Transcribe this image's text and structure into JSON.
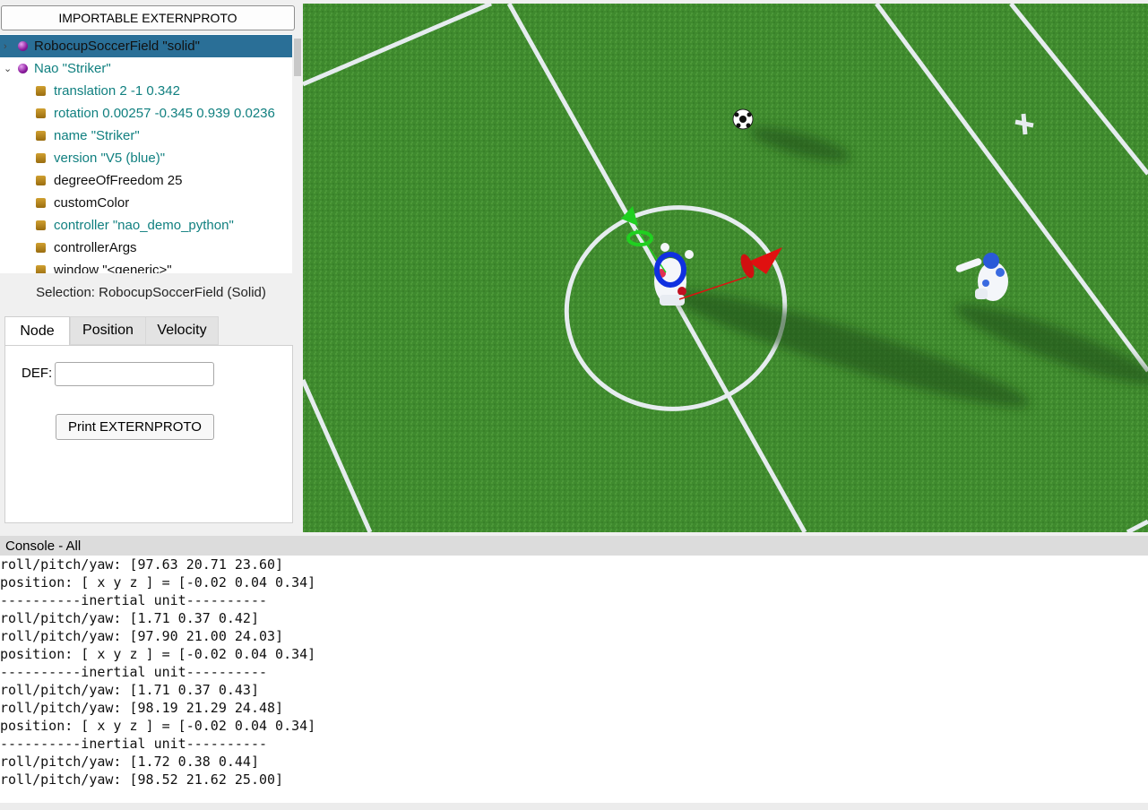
{
  "left_panel": {
    "import_button": "IMPORTABLE EXTERNPROTO",
    "tree": [
      {
        "label": "RobocupSoccerField \"solid\"",
        "kind": "node",
        "expander": "›",
        "selected": true,
        "color": "black"
      },
      {
        "label": "Nao \"Striker\"",
        "kind": "node",
        "expander": "⌄",
        "selected": false,
        "color": "teal"
      },
      {
        "label": "translation 2 -1 0.342",
        "kind": "field",
        "color": "teal"
      },
      {
        "label": "rotation 0.00257 -0.345 0.939 0.0236",
        "kind": "field",
        "color": "teal"
      },
      {
        "label": "name \"Striker\"",
        "kind": "field",
        "color": "teal"
      },
      {
        "label": "version \"V5 (blue)\"",
        "kind": "field",
        "color": "teal"
      },
      {
        "label": "degreeOfFreedom 25",
        "kind": "field",
        "color": "black"
      },
      {
        "label": "customColor",
        "kind": "field",
        "color": "black"
      },
      {
        "label": "controller \"nao_demo_python\"",
        "kind": "field",
        "color": "teal"
      },
      {
        "label": "controllerArgs",
        "kind": "field",
        "color": "black"
      },
      {
        "label": "window \"<generic>\"",
        "kind": "field",
        "color": "black"
      }
    ],
    "selection_text": "Selection: RobocupSoccerField (Solid)",
    "tabs": [
      "Node",
      "Position",
      "Velocity"
    ],
    "active_tab": "Node",
    "def_label": "DEF:",
    "def_value": "",
    "print_button": "Print EXTERNPROTO"
  },
  "console": {
    "title": "Console - All",
    "lines": [
      "roll/pitch/yaw: [97.63 20.71 23.60]",
      "position: [ x y z ] = [-0.02 0.04 0.34]",
      "----------inertial unit----------",
      "roll/pitch/yaw: [1.71 0.37 0.42]",
      "roll/pitch/yaw: [97.90 21.00 24.03]",
      "position: [ x y z ] = [-0.02 0.04 0.34]",
      "----------inertial unit----------",
      "roll/pitch/yaw: [1.71 0.37 0.43]",
      "roll/pitch/yaw: [98.19 21.29 24.48]",
      "position: [ x y z ] = [-0.02 0.04 0.34]",
      "----------inertial unit----------",
      "roll/pitch/yaw: [1.72 0.38 0.44]",
      "roll/pitch/yaw: [98.52 21.62 25.00]"
    ]
  },
  "colors": {
    "grass": "#3f8a2e",
    "selected_row": "#2a6f97",
    "teal_text": "#118080",
    "gizmo_x": "#e01010",
    "gizmo_y": "#20d020",
    "gizmo_rot": "#1030e0"
  }
}
